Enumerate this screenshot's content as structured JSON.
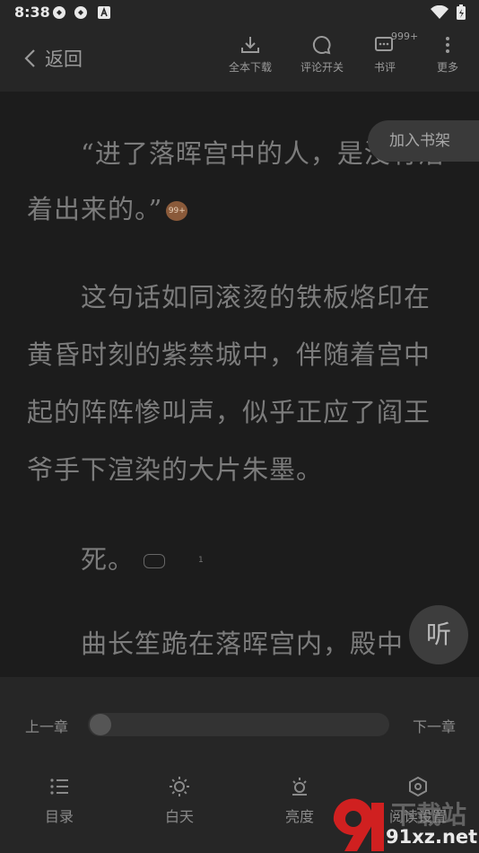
{
  "status_bar": {
    "time": "8:38"
  },
  "toolbar": {
    "back_label": "返回",
    "download_label": "全本下载",
    "comment_toggle_label": "评论开关",
    "review_label": "书评",
    "review_badge": "999+",
    "more_label": "更多"
  },
  "reader": {
    "paragraphs": [
      "“进了落晖宫中的人，是没有活",
      "着出来的。”",
      "这句话如同滚烫的铁板烙印在",
      "黄昏时刻的紫禁城中，伴随着宫中",
      "起的阵阵惨叫声，似乎正应了阎王",
      "爷手下渲染的大片朱墨。",
      "死。",
      "曲长笙跪在落晖宫内，殿中"
    ],
    "comment_badge_1": "99+",
    "comment_badge_2": "1"
  },
  "add_shelf_label": "加入书架",
  "listen_label": "听",
  "chapter_nav": {
    "prev_label": "上一章",
    "next_label": "下一章",
    "progress": 0
  },
  "bottom_nav": {
    "toc_label": "目录",
    "day_label": "白天",
    "brightness_label": "亮度",
    "settings_label": "阅读设置"
  },
  "watermark": {
    "text": "91xz.net",
    "cn": "下载站"
  },
  "colors": {
    "background": "#1c1c1c",
    "panel": "#262626",
    "text": "#7c7c7c"
  }
}
